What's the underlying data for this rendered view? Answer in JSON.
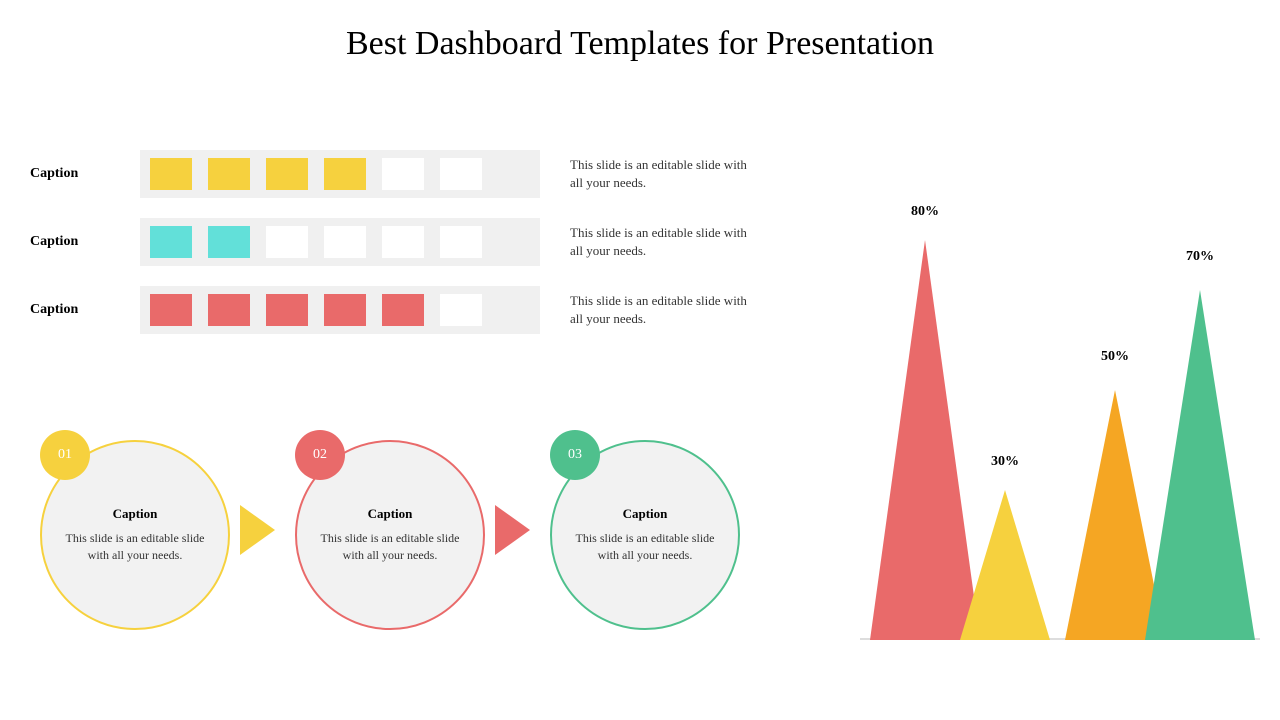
{
  "title": "Best Dashboard Templates for Presentation",
  "ratings": [
    {
      "label": "Caption",
      "filled": 4,
      "total": 6,
      "color": "yellow",
      "desc": "This slide is an editable slide with all your needs."
    },
    {
      "label": "Caption",
      "filled": 2,
      "total": 6,
      "color": "teal",
      "desc": "This slide is an editable slide with all your needs."
    },
    {
      "label": "Caption",
      "filled": 5,
      "total": 6,
      "color": "red",
      "desc": "This slide is an editable slide with all your needs."
    }
  ],
  "circles": [
    {
      "num": "01",
      "color": "yellow",
      "caption": "Caption",
      "desc": "This slide is an editable slide with all your needs."
    },
    {
      "num": "02",
      "color": "red",
      "caption": "Caption",
      "desc": "This slide is an editable slide with all your needs."
    },
    {
      "num": "03",
      "color": "green",
      "caption": "Caption",
      "desc": "This slide is an editable slide with all your needs."
    }
  ],
  "chart_data": {
    "type": "bar",
    "title": "",
    "xlabel": "",
    "ylabel": "",
    "ylim": [
      0,
      100
    ],
    "series": [
      {
        "name": "Red",
        "value": 80,
        "color": "#e96a6a"
      },
      {
        "name": "Yellow",
        "value": 30,
        "color": "#f6d13e"
      },
      {
        "name": "Orange",
        "value": 50,
        "color": "#f5a623"
      },
      {
        "name": "Green",
        "value": 70,
        "color": "#4fc08d"
      }
    ],
    "labels": [
      "80%",
      "30%",
      "50%",
      "70%"
    ]
  },
  "colors": {
    "yellow": "#f6d13e",
    "teal": "#62e0d9",
    "red": "#e96a6a",
    "green": "#4fc08d",
    "orange": "#f5a623"
  }
}
